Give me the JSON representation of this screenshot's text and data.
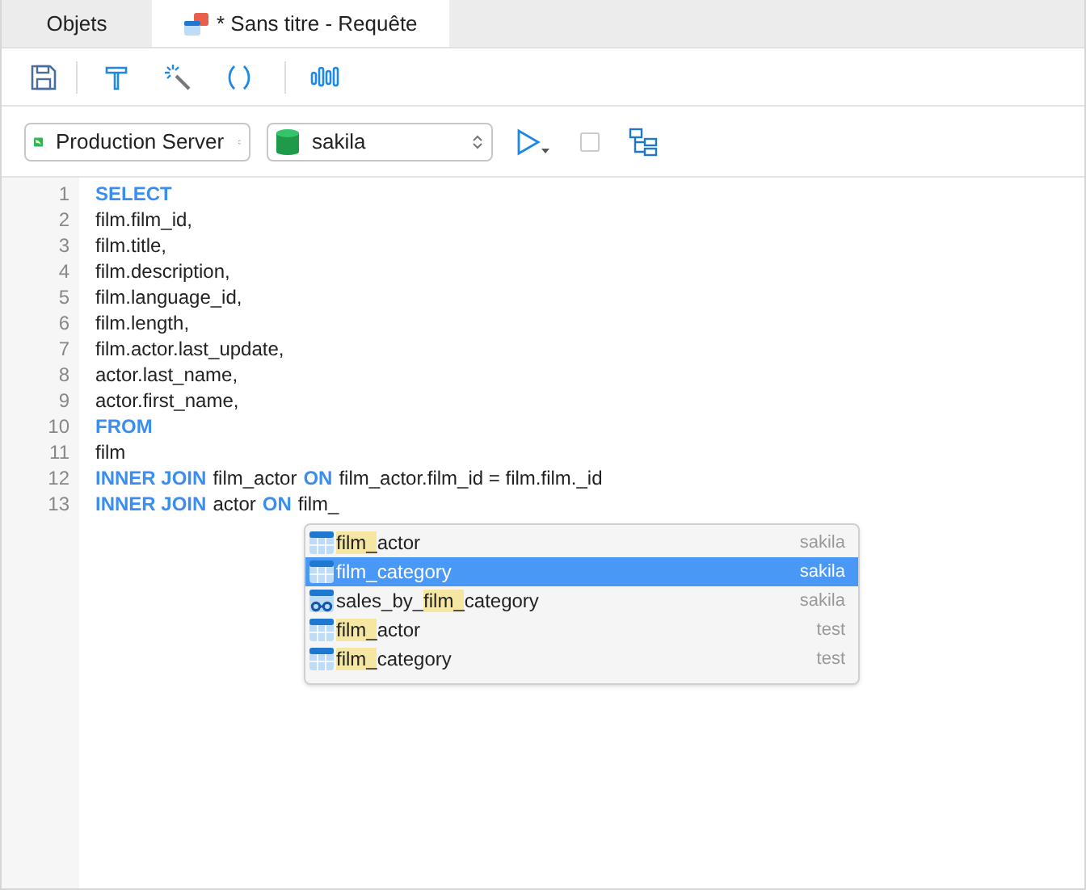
{
  "tabs": [
    {
      "label": "Objets",
      "selected": false,
      "kind": "plain"
    },
    {
      "label": "* Sans titre - Requête",
      "selected": true,
      "kind": "query"
    }
  ],
  "connection": {
    "server": "Production Server",
    "database": "sakila"
  },
  "stop_disabled": true,
  "editor": {
    "lines": [
      {
        "number": "1",
        "tokens": [
          {
            "text": "SELECT",
            "kind": "keyword"
          }
        ]
      },
      {
        "number": "2",
        "tokens": [
          {
            "text": "film.film_id,",
            "kind": "plain"
          }
        ]
      },
      {
        "number": "3",
        "tokens": [
          {
            "text": "film.title,",
            "kind": "plain"
          }
        ]
      },
      {
        "number": "4",
        "tokens": [
          {
            "text": "film.description,",
            "kind": "plain"
          }
        ]
      },
      {
        "number": "5",
        "tokens": [
          {
            "text": "film.language_id,",
            "kind": "plain"
          }
        ]
      },
      {
        "number": "6",
        "tokens": [
          {
            "text": "film.length,",
            "kind": "plain"
          }
        ]
      },
      {
        "number": "7",
        "tokens": [
          {
            "text": "film.actor.last_update,",
            "kind": "plain"
          }
        ]
      },
      {
        "number": "8",
        "tokens": [
          {
            "text": "actor.last_name,",
            "kind": "plain"
          }
        ]
      },
      {
        "number": "9",
        "tokens": [
          {
            "text": "actor.first_name,",
            "kind": "plain"
          }
        ]
      },
      {
        "number": "10",
        "tokens": [
          {
            "text": "FROM",
            "kind": "keyword"
          }
        ]
      },
      {
        "number": "11",
        "tokens": [
          {
            "text": "film",
            "kind": "plain"
          }
        ]
      },
      {
        "number": "12",
        "tokens": [
          {
            "text": "INNER JOIN",
            "kind": "keyword"
          },
          {
            "text": "film_actor",
            "kind": "plain"
          },
          {
            "text": "ON",
            "kind": "keyword"
          },
          {
            "text": "film_actor.film_id = film.film._id",
            "kind": "plain"
          }
        ]
      },
      {
        "number": "13",
        "tokens": [
          {
            "text": "INNER JOIN",
            "kind": "keyword"
          },
          {
            "text": "actor",
            "kind": "plain"
          },
          {
            "text": "ON",
            "kind": "keyword"
          },
          {
            "text": "film_",
            "kind": "plain"
          }
        ]
      }
    ]
  },
  "autocomplete": [
    {
      "kind": "table",
      "selected": false,
      "segments": [
        {
          "text": "film_",
          "highlight": true
        },
        {
          "text": "actor",
          "highlight": false
        }
      ],
      "schema": "sakila"
    },
    {
      "kind": "table",
      "selected": true,
      "segments": [
        {
          "text": "film_",
          "highlight": false
        },
        {
          "text": "category",
          "highlight": false
        }
      ],
      "schema": "sakila"
    },
    {
      "kind": "view",
      "selected": false,
      "segments": [
        {
          "text": "sales_by_",
          "highlight": false
        },
        {
          "text": "film_",
          "highlight": true
        },
        {
          "text": "category",
          "highlight": false
        }
      ],
      "schema": "sakila"
    },
    {
      "kind": "table",
      "selected": false,
      "segments": [
        {
          "text": "film_",
          "highlight": true
        },
        {
          "text": "actor",
          "highlight": false
        }
      ],
      "schema": "test"
    },
    {
      "kind": "table",
      "selected": false,
      "segments": [
        {
          "text": "film_",
          "highlight": true
        },
        {
          "text": "category",
          "highlight": false
        }
      ],
      "schema": "test"
    }
  ]
}
